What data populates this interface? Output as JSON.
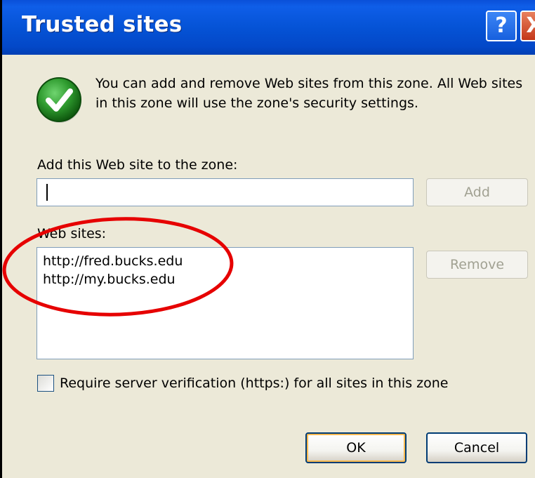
{
  "window": {
    "title": "Trusted sites",
    "help_glyph": "?",
    "close_glyph": "X"
  },
  "info": {
    "icon": "green-checkmark-icon",
    "text": "You can add and remove Web sites from this zone. All Web sites in this zone will use the zone's security settings."
  },
  "add_site": {
    "label": "Add this Web site to the zone:",
    "value": "",
    "button_label": "Add"
  },
  "web_sites": {
    "label": "Web sites:",
    "items": [
      "http://fred.bucks.edu",
      "http://my.bucks.edu"
    ],
    "remove_label": "Remove"
  },
  "verification": {
    "label": "Require server verification (https:) for all sites in this zone",
    "checked": false
  },
  "footer": {
    "ok_label": "OK",
    "cancel_label": "Cancel"
  },
  "colors": {
    "titlebar": "#0553d6",
    "dialog_bg": "#ece9d8",
    "annotation_red": "#e60000",
    "check_green": "#2e8b2e"
  }
}
